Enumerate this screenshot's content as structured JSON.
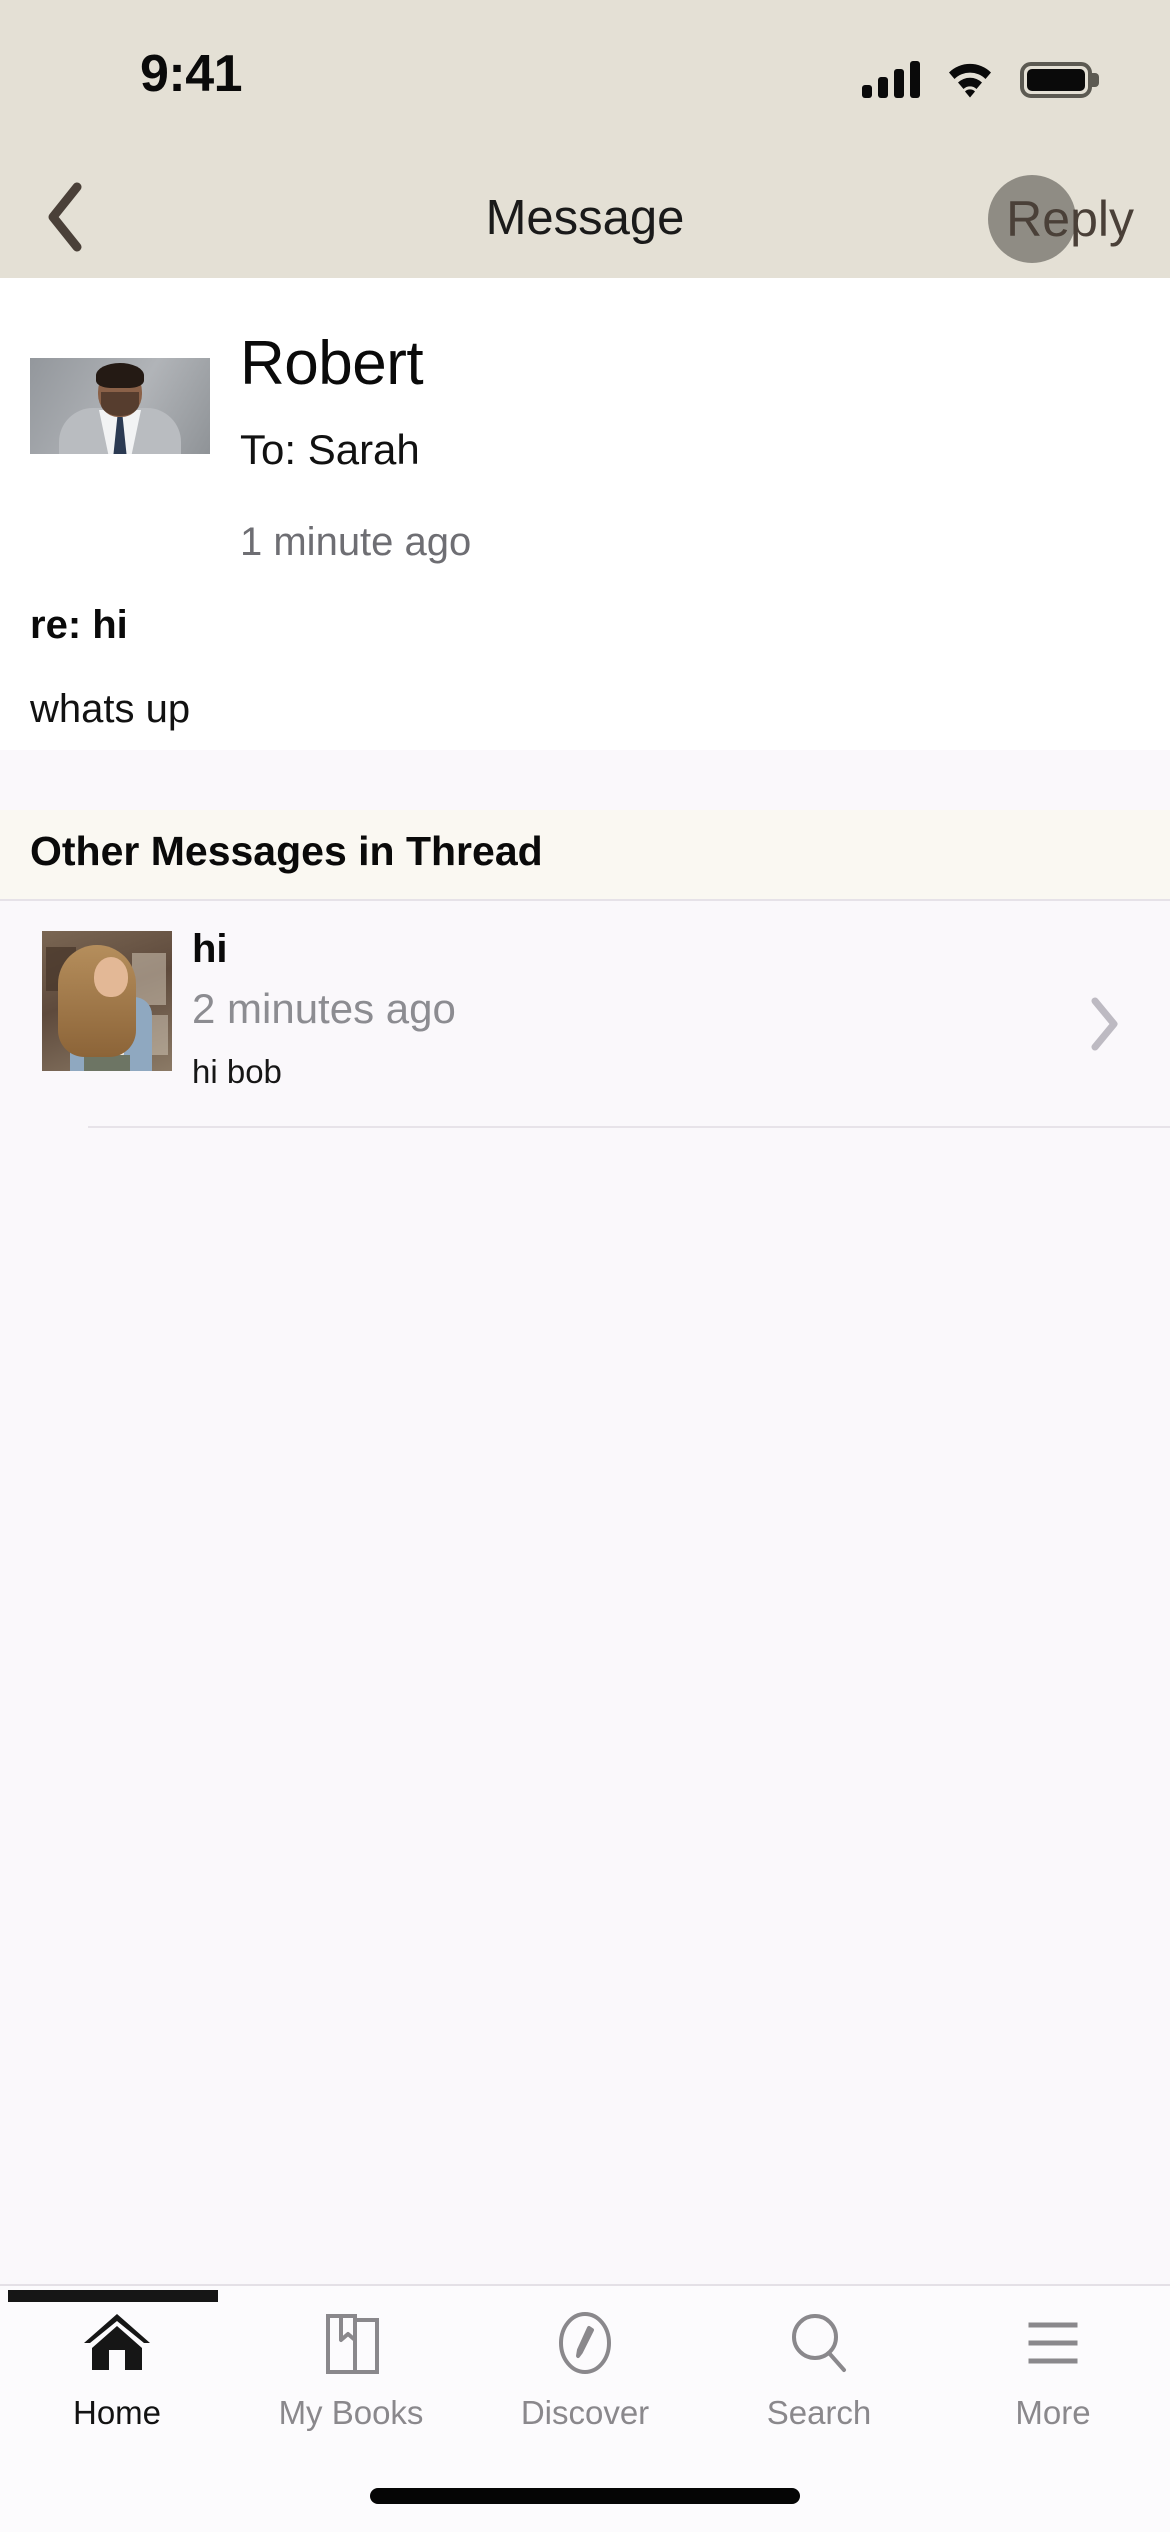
{
  "status_bar": {
    "time": "9:41",
    "signal_icon": "cellular-signal-icon",
    "wifi_icon": "wifi-icon",
    "battery_icon": "battery-full-icon",
    "background_color": "#E4E0D5"
  },
  "nav_bar": {
    "back_icon": "chevron-left-icon",
    "title": "Message",
    "reply_label": "Reply",
    "tap_indicator": "tap-highlight-circle",
    "background_color": "#E4E0D5",
    "text_color": "#4A4038"
  },
  "message": {
    "avatar_icon": "sender-avatar-photo",
    "sender_name": "Robert",
    "recipient": "To: Sarah",
    "timestamp": "1 minute ago",
    "subject": "re: hi",
    "body": "whats up"
  },
  "thread_section": {
    "header": "Other Messages in Thread",
    "items": [
      {
        "avatar_icon": "thread-avatar-photo",
        "title": "hi",
        "timestamp": "2 minutes ago",
        "preview": "hi bob",
        "disclosure_icon": "chevron-right-icon"
      }
    ]
  },
  "tab_bar": {
    "active_index": 0,
    "tabs": [
      {
        "label": "Home",
        "icon": "home-icon"
      },
      {
        "label": "My Books",
        "icon": "books-icon"
      },
      {
        "label": "Discover",
        "icon": "compass-icon"
      },
      {
        "label": "Search",
        "icon": "search-icon"
      },
      {
        "label": "More",
        "icon": "menu-hamburger-icon"
      }
    ]
  },
  "home_indicator": "home-indicator-bar"
}
